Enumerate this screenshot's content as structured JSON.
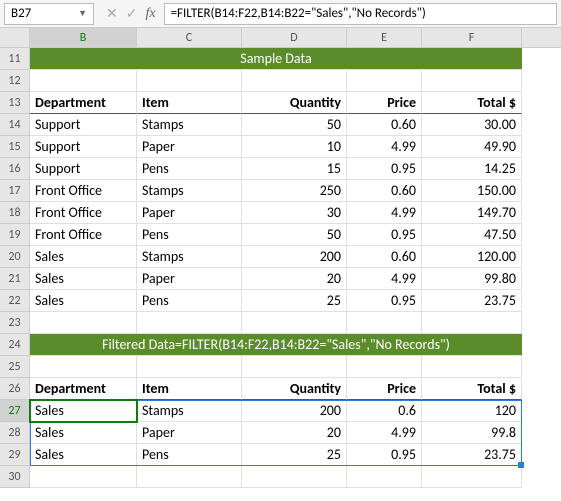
{
  "namebox": "B27",
  "formula": "=FILTER(B14:F22,B14:B22=\"Sales\",\"No Records\")",
  "columns": [
    "B",
    "C",
    "D",
    "E",
    "F"
  ],
  "banners": {
    "sample": "Sample Data",
    "filtered": "Filtered Data=FILTER(B14:F22,B14:B22=\"Sales\",\"No Records\")"
  },
  "headers": {
    "dept": "Department",
    "item": "Item",
    "qty": "Quantity",
    "price": "Price",
    "total": "Total  $"
  },
  "chart_data": {
    "type": "table",
    "title": "Sample Data",
    "columns": [
      "Department",
      "Item",
      "Quantity",
      "Price",
      "Total $"
    ],
    "rows": [
      [
        "Support",
        "Stamps",
        50,
        0.6,
        30.0
      ],
      [
        "Support",
        "Paper",
        10,
        4.99,
        49.9
      ],
      [
        "Support",
        "Pens",
        15,
        0.95,
        14.25
      ],
      [
        "Front Office",
        "Stamps",
        250,
        0.6,
        150.0
      ],
      [
        "Front Office",
        "Paper",
        30,
        4.99,
        149.7
      ],
      [
        "Front Office",
        "Pens",
        50,
        0.95,
        47.5
      ],
      [
        "Sales",
        "Stamps",
        200,
        0.6,
        120.0
      ],
      [
        "Sales",
        "Paper",
        20,
        4.99,
        99.8
      ],
      [
        "Sales",
        "Pens",
        25,
        0.95,
        23.75
      ]
    ],
    "filtered": {
      "criteria": "Department = Sales",
      "rows": [
        [
          "Sales",
          "Stamps",
          200,
          0.6,
          120
        ],
        [
          "Sales",
          "Paper",
          20,
          4.99,
          99.8
        ],
        [
          "Sales",
          "Pens",
          25,
          0.95,
          23.75
        ]
      ]
    }
  },
  "table": {
    "r14": {
      "b": "Support",
      "c": "Stamps",
      "d": "50",
      "e": "0.60",
      "f": "30.00"
    },
    "r15": {
      "b": "Support",
      "c": "Paper",
      "d": "10",
      "e": "4.99",
      "f": "49.90"
    },
    "r16": {
      "b": "Support",
      "c": "Pens",
      "d": "15",
      "e": "0.95",
      "f": "14.25"
    },
    "r17": {
      "b": "Front Office",
      "c": "Stamps",
      "d": "250",
      "e": "0.60",
      "f": "150.00"
    },
    "r18": {
      "b": "Front Office",
      "c": "Paper",
      "d": "30",
      "e": "4.99",
      "f": "149.70"
    },
    "r19": {
      "b": "Front Office",
      "c": "Pens",
      "d": "50",
      "e": "0.95",
      "f": "47.50"
    },
    "r20": {
      "b": "Sales",
      "c": "Stamps",
      "d": "200",
      "e": "0.60",
      "f": "120.00"
    },
    "r21": {
      "b": "Sales",
      "c": "Paper",
      "d": "20",
      "e": "4.99",
      "f": "99.80"
    },
    "r22": {
      "b": "Sales",
      "c": "Pens",
      "d": "25",
      "e": "0.95",
      "f": "23.75"
    }
  },
  "filtered": {
    "r27": {
      "b": "Sales",
      "c": "Stamps",
      "d": "200",
      "e": "0.6",
      "f": "120"
    },
    "r28": {
      "b": "Sales",
      "c": "Paper",
      "d": "20",
      "e": "4.99",
      "f": "99.8"
    },
    "r29": {
      "b": "Sales",
      "c": "Pens",
      "d": "25",
      "e": "0.95",
      "f": "23.75"
    }
  },
  "rownums": {
    "r11": "11",
    "r12": "12",
    "r13": "13",
    "r14": "14",
    "r15": "15",
    "r16": "16",
    "r17": "17",
    "r18": "18",
    "r19": "19",
    "r20": "20",
    "r21": "21",
    "r22": "22",
    "r23": "23",
    "r24": "24",
    "r25": "25",
    "r26": "26",
    "r27": "27",
    "r28": "28",
    "r29": "29",
    "r30": "30"
  }
}
